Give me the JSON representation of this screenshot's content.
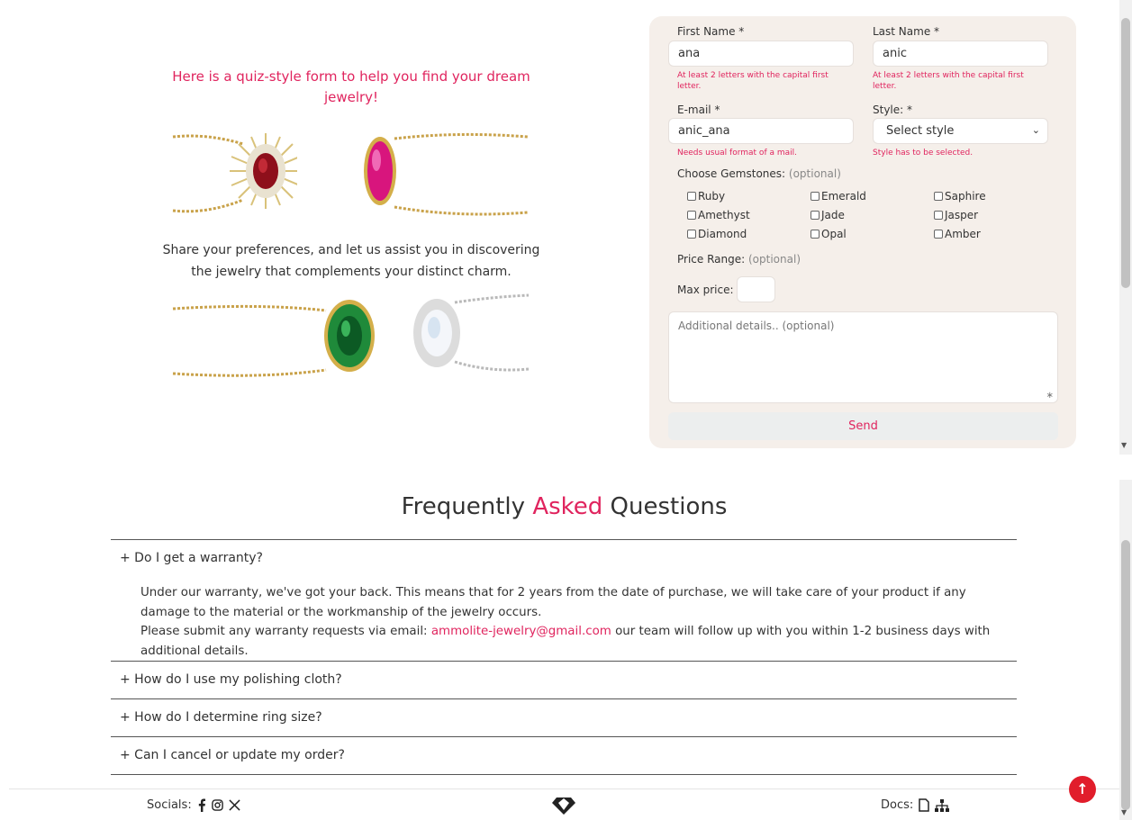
{
  "intro": {
    "title": "Here is a quiz-style form to help you find your dream jewelry!",
    "text": "Share your preferences, and let us assist you in discovering the jewelry that complements your distinct charm."
  },
  "form": {
    "first_name": {
      "label": "First Name *",
      "value": "ana",
      "error": "At least 2 letters with the capital first letter."
    },
    "last_name": {
      "label": "Last Name *",
      "value": "anic",
      "error": "At least 2 letters with the capital first letter."
    },
    "email": {
      "label": "E-mail *",
      "value": "anic_ana",
      "error": "Needs usual format of a mail."
    },
    "style": {
      "label": "Style: *",
      "selected": "Select style",
      "error": "Style has to be selected."
    },
    "gemstones": {
      "label": "Choose Gemstones:",
      "optional": "(optional)",
      "options": [
        "Ruby",
        "Emerald",
        "Saphire",
        "Amethyst",
        "Jade",
        "Jasper",
        "Diamond",
        "Opal",
        "Amber"
      ]
    },
    "price_range": {
      "label": "Price Range:",
      "optional": "(optional)"
    },
    "max_price": {
      "label": "Max price:",
      "value": ""
    },
    "details_placeholder": "Additional details.. (optional)",
    "send_label": "Send"
  },
  "faq": {
    "title_pre": "Frequently ",
    "title_accent": "Asked",
    "title_post": " Questions",
    "items": [
      {
        "q": "+ Do I get a warranty?"
      },
      {
        "q": "+ How do I use my polishing cloth?"
      },
      {
        "q": "+ How do I determine ring size?"
      },
      {
        "q": "+ Can I cancel or update my order?"
      }
    ],
    "answer": {
      "p1": "Under our warranty, we've got your back. This means that for 2 years from the date of purchase, we will take care of your product if any damage to the material or the workmanship of the jewelry occurs.",
      "p2_pre": "Please submit any warranty requests via email: ",
      "email": "ammolite-jewelry@gmail.com",
      "p2_post": " our team will follow up with you within 1-2 business days with additional details."
    }
  },
  "footer": {
    "socials_label": "Socials:",
    "docs_label": "Docs:",
    "icons": [
      "facebook-icon",
      "instagram-icon",
      "x-icon",
      "document-icon",
      "sitemap-icon",
      "diamond-logo"
    ]
  },
  "colors": {
    "accent": "#e0245e",
    "form_bg": "#f5efea",
    "top_button": "#e11d2b"
  }
}
